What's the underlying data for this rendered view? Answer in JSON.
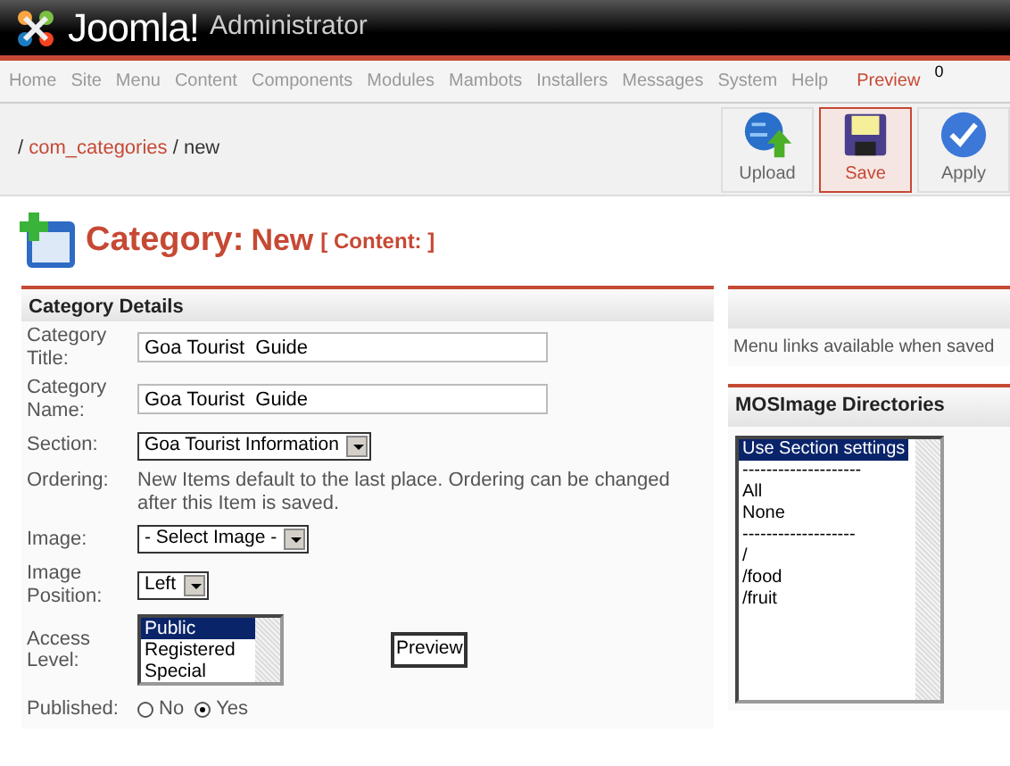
{
  "header": {
    "brand": "Joomla!",
    "subtitle": "Administrator"
  },
  "menu": {
    "items": [
      "Home",
      "Site",
      "Menu",
      "Content",
      "Components",
      "Modules",
      "Mambots",
      "Installers",
      "Messages",
      "System",
      "Help"
    ],
    "preview": "Preview",
    "count": "0"
  },
  "breadcrumb": {
    "parts": [
      {
        "text": "/ ",
        "link": false
      },
      {
        "text": "com_categories",
        "link": true
      },
      {
        "text": " / new",
        "link": false
      }
    ]
  },
  "toolbar": [
    {
      "label": "Upload",
      "kind": "upload",
      "selected": false
    },
    {
      "label": "Save",
      "kind": "save",
      "selected": true
    },
    {
      "label": "Apply",
      "kind": "apply",
      "selected": false
    }
  ],
  "page_title": {
    "main": "Category:",
    "sub": "New",
    "context": "[ Content: ]"
  },
  "details": {
    "title": "Category Details",
    "fields": [
      {
        "kind": "text",
        "label": "Category Title:",
        "value": "Goa Tourist  Guide"
      },
      {
        "kind": "text",
        "label": "Category Name:",
        "value": "Goa Tourist  Guide"
      },
      {
        "kind": "select",
        "label": "Section:",
        "value": "Goa Tourist Information"
      },
      {
        "kind": "note",
        "label": "Ordering:",
        "value": "New Items default to the last place. Ordering can be changed after this Item is saved."
      },
      {
        "kind": "select",
        "label": "Image:",
        "value": "- Select Image -"
      },
      {
        "kind": "select",
        "label": "Image Position:",
        "value": "Left"
      },
      {
        "kind": "list",
        "label": "Access Level:",
        "options": [
          {
            "text": "Public",
            "selected": true
          },
          {
            "text": "Registered",
            "selected": false
          },
          {
            "text": "Special",
            "selected": false
          }
        ],
        "button": "Preview"
      },
      {
        "kind": "radio",
        "label": "Published:",
        "options": [
          {
            "text": "No",
            "selected": false
          },
          {
            "text": "Yes",
            "selected": true
          }
        ]
      }
    ]
  },
  "menu_links": {
    "note": "Menu links available when saved"
  },
  "mosimage": {
    "title": "MOSImage Directories",
    "options": [
      {
        "text": "Use Section settings",
        "selected": true
      },
      {
        "text": "--------------------",
        "selected": false
      },
      {
        "text": "All",
        "selected": false
      },
      {
        "text": "None",
        "selected": false
      },
      {
        "text": "-------------------",
        "selected": false
      },
      {
        "text": "/",
        "selected": false
      },
      {
        "text": "/food",
        "selected": false
      },
      {
        "text": "/fruit",
        "selected": false
      }
    ]
  }
}
